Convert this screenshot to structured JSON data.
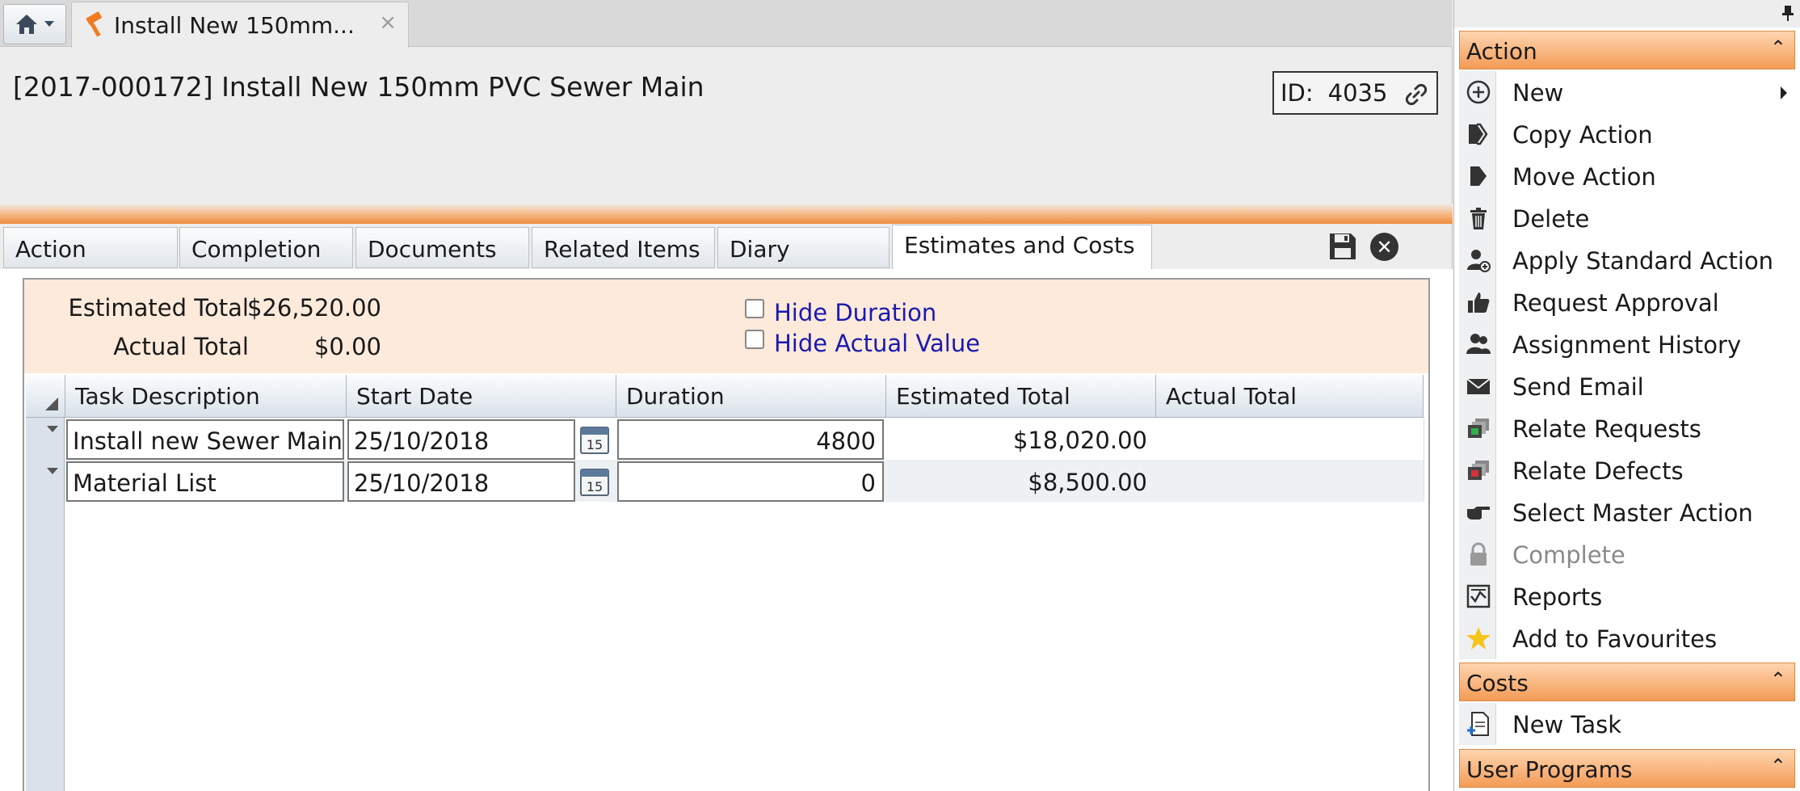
{
  "tabstrip": {
    "doc_tab_label": "Install New 150mm...",
    "doc_tab_close": "×"
  },
  "header": {
    "title": "[2017-000172] Install New 150mm PVC Sewer Main",
    "id_label": "ID:",
    "id_value": "4035"
  },
  "tabs": [
    {
      "label": "Action"
    },
    {
      "label": "Completion"
    },
    {
      "label": "Documents"
    },
    {
      "label": "Related Items"
    },
    {
      "label": "Diary"
    },
    {
      "label": "Estimates and Costs",
      "active": true
    }
  ],
  "toolbar": {
    "close_glyph": "✕"
  },
  "summary": {
    "estimated_total_label": "Estimated Total",
    "estimated_total_value": "$26,520.00",
    "actual_total_label": "Actual Total",
    "actual_total_value": "$0.00",
    "hide_duration_label": "Hide Duration",
    "hide_actual_value_label": "Hide Actual Value"
  },
  "grid": {
    "columns": [
      "Task Description",
      "Start Date",
      "Duration",
      "Estimated Total",
      "Actual Total"
    ],
    "rows": [
      {
        "task": "Install new Sewer Main",
        "start": "25/10/2018",
        "duration": "4800",
        "estimated": "$18,020.00",
        "actual": ""
      },
      {
        "task": "Material List",
        "start": "25/10/2018",
        "duration": "0",
        "estimated": "$8,500.00",
        "actual": ""
      }
    ],
    "calendar_day": "15"
  },
  "sidebar": {
    "sections": {
      "action": "Action",
      "costs": "Costs",
      "user_programs": "User Programs"
    },
    "action_items": [
      {
        "label": "New",
        "icon": "plus-circle-icon"
      },
      {
        "label": "Copy Action",
        "icon": "copy-action-icon"
      },
      {
        "label": "Move Action",
        "icon": "move-action-icon"
      },
      {
        "label": "Delete",
        "icon": "trash-icon"
      },
      {
        "label": "Apply Standard Action",
        "icon": "user-add-icon"
      },
      {
        "label": "Request Approval",
        "icon": "thumbs-up-icon"
      },
      {
        "label": "Assignment History",
        "icon": "users-icon"
      },
      {
        "label": "Send Email",
        "icon": "envelope-icon"
      },
      {
        "label": "Relate Requests",
        "icon": "relate-requests-icon"
      },
      {
        "label": "Relate Defects",
        "icon": "relate-defects-icon"
      },
      {
        "label": "Select Master Action",
        "icon": "pointing-hand-icon"
      },
      {
        "label": "Complete",
        "icon": "lock-icon"
      },
      {
        "label": "Reports",
        "icon": "report-icon"
      },
      {
        "label": "Add to Favourites",
        "icon": "star-icon"
      }
    ],
    "cost_items": [
      {
        "label": "New Task",
        "icon": "new-task-icon"
      }
    ]
  },
  "colors": {
    "accent_orange": "#f39b55",
    "link_blue": "#1a1ab0",
    "summary_bg": "#fdeadb"
  }
}
